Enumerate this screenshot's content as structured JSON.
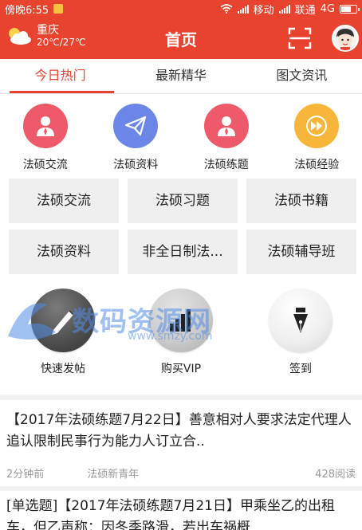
{
  "status_bar": {
    "time": "傍晚6:55",
    "carrier1": "移动",
    "carrier2": "联通",
    "network": "4G",
    "battery_level": 0.7
  },
  "header": {
    "city": "重庆",
    "temperature": "20℃/27℃",
    "title": "首页",
    "scan_icon": "scan-icon",
    "avatar_icon": "avatar-icon"
  },
  "tabs": [
    {
      "label": "今日热门",
      "active": true
    },
    {
      "label": "最新精华",
      "active": false
    },
    {
      "label": "图文资讯",
      "active": false
    }
  ],
  "categories": [
    {
      "label": "法硕交流",
      "icon": "person-icon",
      "color": "#ef5a6a"
    },
    {
      "label": "法硕资料",
      "icon": "paper-plane-icon",
      "color": "#6b86e6"
    },
    {
      "label": "法硕练题",
      "icon": "person-icon",
      "color": "#ef5a6a"
    },
    {
      "label": "法硕经验",
      "icon": "fast-forward-icon",
      "color": "#f7b63a"
    }
  ],
  "grid": [
    "法硕交流",
    "法硕习题",
    "法硕书籍",
    "法硕资料",
    "非全日制法...",
    "法硕辅导班"
  ],
  "actions": [
    {
      "label": "快速发帖",
      "icon": "pen-icon"
    },
    {
      "label": "购买VIP",
      "icon": "vip-icon"
    },
    {
      "label": "签到",
      "icon": "fountain-pen-icon"
    }
  ],
  "watermark": {
    "text": "数码资源网",
    "url": "www.smzy.com"
  },
  "news": [
    {
      "title": "【2017年法硕练题7月22日】善意相对人要求法定代理人追认限制民事行为能力人订立合..",
      "time": "2分钟前",
      "source": "法硕新青年",
      "reads": "428阅读"
    },
    {
      "title": "[单选题]【2017年法硕练题7月21日】甲乘坐乙的出租车，但乙声称：因冬季路滑，若出车祸概"
    }
  ]
}
